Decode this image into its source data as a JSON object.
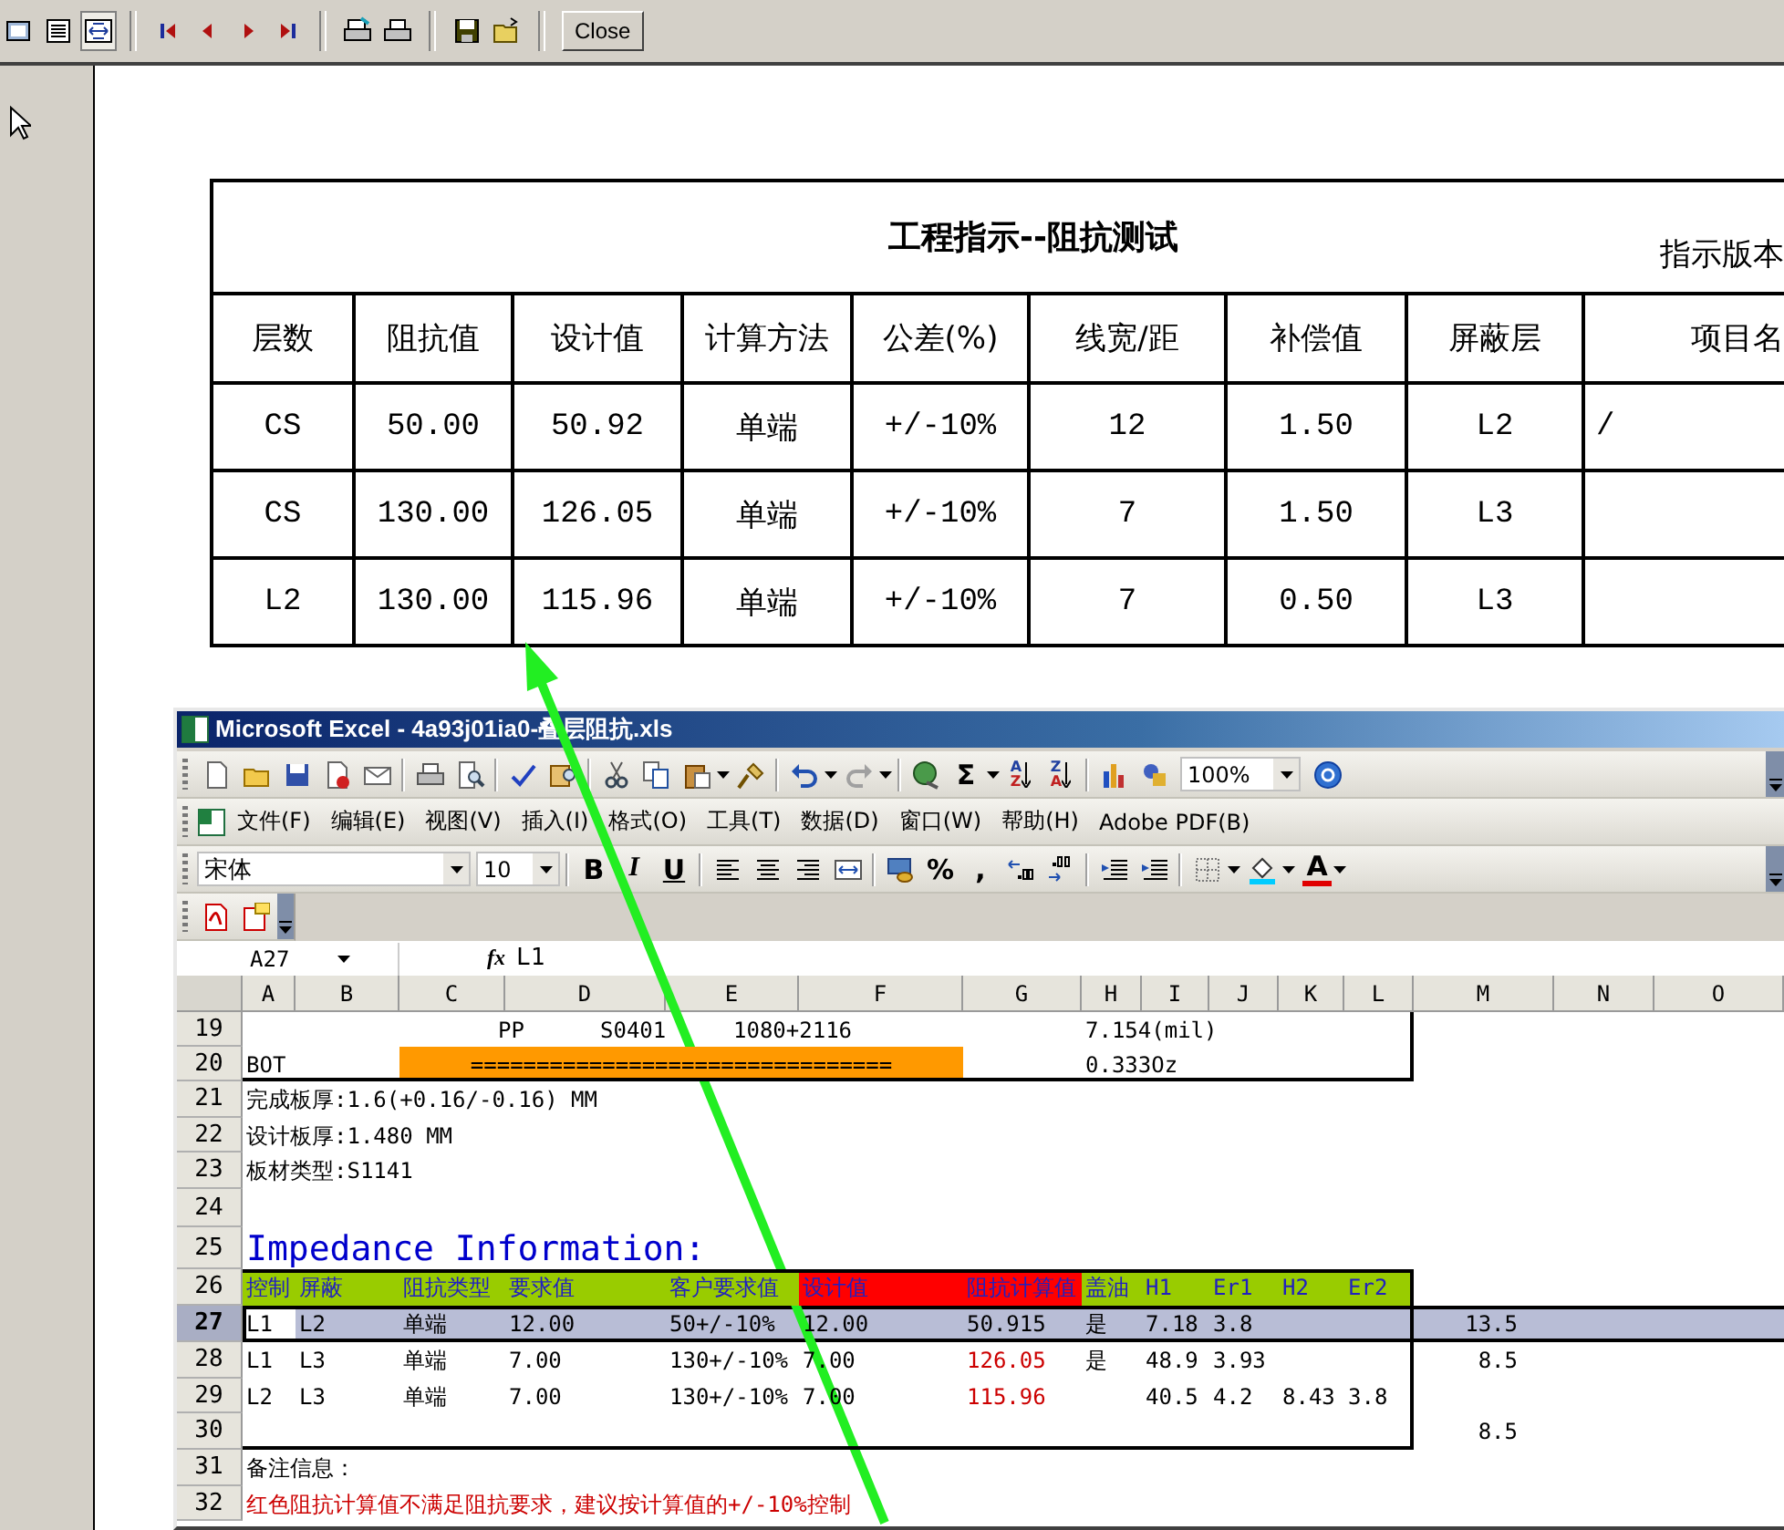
{
  "viewer_toolbar": {
    "close_button": "Close"
  },
  "report": {
    "title": "工程指示--阻抗测试",
    "version_label": "指示版本",
    "columns": [
      "层数",
      "阻抗值",
      "设计值",
      "计算方法",
      "公差(%)",
      "线宽/距",
      "补偿值",
      "屏蔽层",
      "项目名"
    ],
    "rows": [
      {
        "cells": [
          "CS",
          "50.00",
          "50.92",
          "单端",
          "+/-10%",
          "12",
          "1.50",
          "L2",
          "/"
        ]
      },
      {
        "cells": [
          "CS",
          "130.00",
          "126.05",
          "单端",
          "+/-10%",
          "7",
          "1.50",
          "L3"
        ]
      },
      {
        "cells": [
          "L2",
          "130.00",
          "115.96",
          "单端",
          "+/-10%",
          "7",
          "0.50",
          "L3"
        ]
      }
    ]
  },
  "excel": {
    "title": "Microsoft Excel - 4a93j01ia0-叠层阻抗.xls",
    "standard_toolbar": {
      "autosum": "Σ",
      "sort_ascending": [
        "A",
        "Z"
      ],
      "sort_descending": [
        "Z",
        "A"
      ],
      "zoom": "100%"
    },
    "menu": [
      "文件(F)",
      "编辑(E)",
      "视图(V)",
      "插入(I)",
      "格式(O)",
      "工具(T)",
      "数据(D)",
      "窗口(W)",
      "帮助(H)",
      "Adobe PDF(B)"
    ],
    "formatting_toolbar": {
      "font": "宋体",
      "size": "10",
      "bold": "B",
      "italic": "I",
      "underline": "U",
      "percent": "%",
      "comma": ",",
      "font_color": "A"
    },
    "name_box": "A27",
    "formula_label": "fx",
    "formula": "L1",
    "columns": [
      "A",
      "B",
      "C",
      "D",
      "E",
      "F",
      "G",
      "H",
      "I",
      "J",
      "K",
      "L",
      "M",
      "N",
      "O"
    ],
    "rows": [
      {
        "number": "19",
        "selected": false,
        "cells": [
          {
            "text": "PP"
          },
          {
            "text": "S0401"
          },
          {
            "text": "1080+2116"
          },
          {
            "text": "7.154(mil)"
          }
        ]
      },
      {
        "number": "20",
        "selected": false,
        "cells": [
          {
            "text": "BOT"
          },
          {
            "text": "================================",
            "color": "#ff9900"
          },
          {
            "text": "0.333Oz"
          }
        ]
      },
      {
        "number": "21",
        "selected": false,
        "cells": [
          {
            "text": "完成板厚:1.6(+0.16/-0.16) MM"
          }
        ]
      },
      {
        "number": "22",
        "selected": false,
        "cells": [
          {
            "text": "设计板厚:1.480 MM"
          }
        ]
      },
      {
        "number": "23",
        "selected": false,
        "cells": [
          {
            "text": "板材类型:S1141"
          }
        ]
      },
      {
        "number": "24",
        "selected": false
      },
      {
        "number": "25",
        "selected": false,
        "cells": [
          {
            "text": "Impedance Information:",
            "color": "#0000cc"
          }
        ]
      },
      {
        "number": "26",
        "selected": false,
        "cells": [
          {
            "text": "控制",
            "color": "#99cc00"
          },
          {
            "text": "屏蔽",
            "color": "#99cc00"
          },
          {
            "text": "阻抗类型",
            "color": "#99cc00"
          },
          {
            "text": "要求值",
            "color": "#99cc00"
          },
          {
            "text": "客户要求值",
            "color": "#99cc00"
          },
          {
            "text": "设计值",
            "color": "#ff0000"
          },
          {
            "text": "阻抗计算值",
            "color": "#ff0000"
          },
          {
            "text": "盖油",
            "color": "#99cc00"
          },
          {
            "text": "H1",
            "color": "#99cc00"
          },
          {
            "text": "Er1",
            "color": "#99cc00"
          },
          {
            "text": "H2",
            "color": "#99cc00"
          },
          {
            "text": "Er2",
            "color": "#99cc00"
          }
        ]
      },
      {
        "number": "27",
        "selected": true,
        "cells": [
          {
            "text": "L1"
          },
          {
            "text": "L2"
          },
          {
            "text": "单端"
          },
          {
            "text": "12.00"
          },
          {
            "text": "50+/-10%"
          },
          {
            "text": "12.00"
          },
          {
            "text": "50.915"
          },
          {
            "text": "是"
          },
          {
            "text": "7.18"
          },
          {
            "text": "3.8"
          },
          {
            "text": "13.5"
          }
        ]
      },
      {
        "number": "28",
        "selected": false,
        "cells": [
          {
            "text": "L1"
          },
          {
            "text": "L3"
          },
          {
            "text": "单端"
          },
          {
            "text": "7.00"
          },
          {
            "text": "130+/-10%"
          },
          {
            "text": "7.00"
          },
          {
            "text": "126.05",
            "color": "#cc0000"
          },
          {
            "text": "是"
          },
          {
            "text": "48.9"
          },
          {
            "text": "3.93"
          },
          {
            "text": "8.5"
          }
        ]
      },
      {
        "number": "29",
        "selected": false,
        "cells": [
          {
            "text": "L2"
          },
          {
            "text": "L3"
          },
          {
            "text": "单端"
          },
          {
            "text": "7.00"
          },
          {
            "text": "130+/-10%"
          },
          {
            "text": "7.00"
          },
          {
            "text": "115.96",
            "color": "#cc0000"
          },
          {
            "text": "40.5"
          },
          {
            "text": "4.2"
          },
          {
            "text": "8.43"
          },
          {
            "text": "3.8"
          }
        ]
      },
      {
        "number": "30",
        "selected": false,
        "cells": [
          {
            "text": "8.5"
          }
        ]
      },
      {
        "number": "31",
        "selected": false,
        "cells": [
          {
            "text": "备注信息："
          }
        ]
      },
      {
        "number": "32",
        "selected": false,
        "cells": [
          {
            "text": "红色阻抗计算值不满足阻抗要求，建议按计算值的+/-10%控制",
            "color": "#cc0000"
          }
        ]
      }
    ]
  }
}
